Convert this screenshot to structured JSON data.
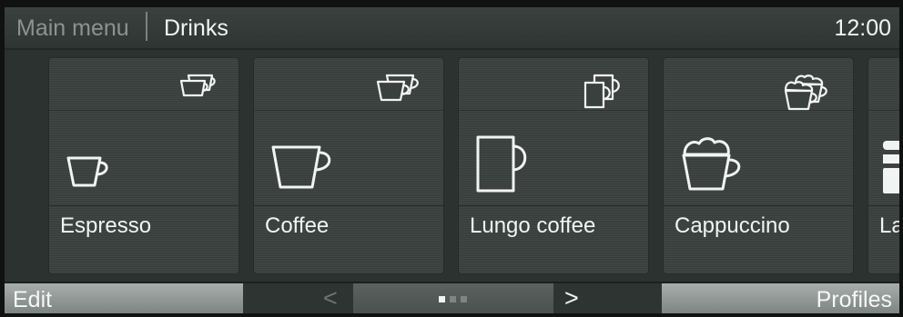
{
  "header": {
    "breadcrumb_root": "Main menu",
    "breadcrumb_current": "Drinks",
    "time": "12:00"
  },
  "drinks": [
    {
      "label": "Espresso",
      "icon": "espresso-cup-icon"
    },
    {
      "label": "Coffee",
      "icon": "coffee-cup-icon"
    },
    {
      "label": "Lungo coffee",
      "icon": "lungo-mug-icon"
    },
    {
      "label": "Cappuccino",
      "icon": "cappuccino-cup-icon"
    },
    {
      "label": "La",
      "icon": "latte-glass-icon"
    }
  ],
  "footer": {
    "edit_label": "Edit",
    "prev_label": "<",
    "next_label": ">",
    "profiles_label": "Profiles",
    "pager": {
      "pages": 3,
      "current": 1
    }
  },
  "colors": {
    "text": "#f2f4f3",
    "muted_text": "#8b9390",
    "card": "#3a403e",
    "soft_button": "#9aa09e"
  }
}
